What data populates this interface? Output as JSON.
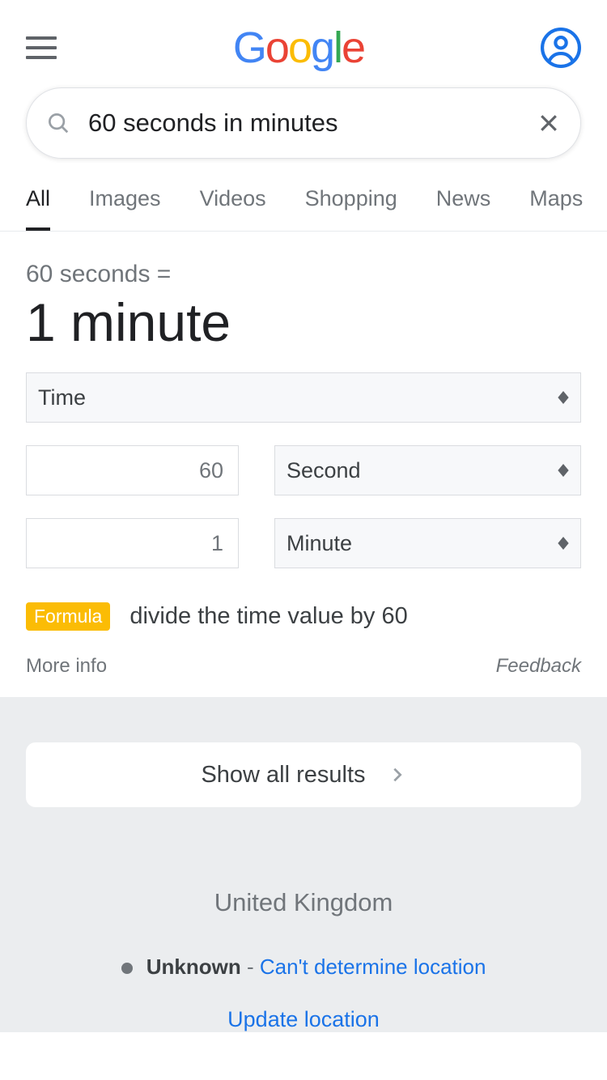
{
  "search": {
    "query": "60 seconds in minutes"
  },
  "tabs": [
    "All",
    "Images",
    "Videos",
    "Shopping",
    "News",
    "Maps"
  ],
  "converter": {
    "equation": "60 seconds =",
    "answer": "1 minute",
    "category": "Time",
    "from_value": "60",
    "from_unit": "Second",
    "to_value": "1",
    "to_unit": "Minute",
    "formula_label": "Formula",
    "formula_text": "divide the time value by 60",
    "more_info": "More info",
    "feedback": "Feedback"
  },
  "footer": {
    "show_all": "Show all results",
    "country": "United Kingdom",
    "location_status": "Unknown",
    "location_sep": " - ",
    "location_detail": "Can't determine location",
    "update_location": "Update location"
  }
}
